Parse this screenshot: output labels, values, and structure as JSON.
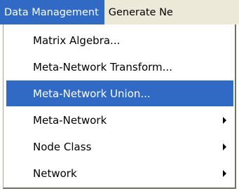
{
  "menubar": {
    "items": [
      {
        "label": "Data Management"
      },
      {
        "label": "Generate Ne"
      }
    ]
  },
  "menu": {
    "items": [
      {
        "label": "Matrix Algebra...",
        "submenu": false
      },
      {
        "label": "Meta-Network Transform...",
        "submenu": false
      },
      {
        "label": "Meta-Network Union...",
        "submenu": false,
        "highlighted": true
      },
      {
        "label": "Meta-Network",
        "submenu": true
      },
      {
        "label": "Node Class",
        "submenu": true
      },
      {
        "label": "Network",
        "submenu": true
      }
    ]
  },
  "colors": {
    "highlight": "#316ac5",
    "menubar_bg": "#ece9d8"
  }
}
